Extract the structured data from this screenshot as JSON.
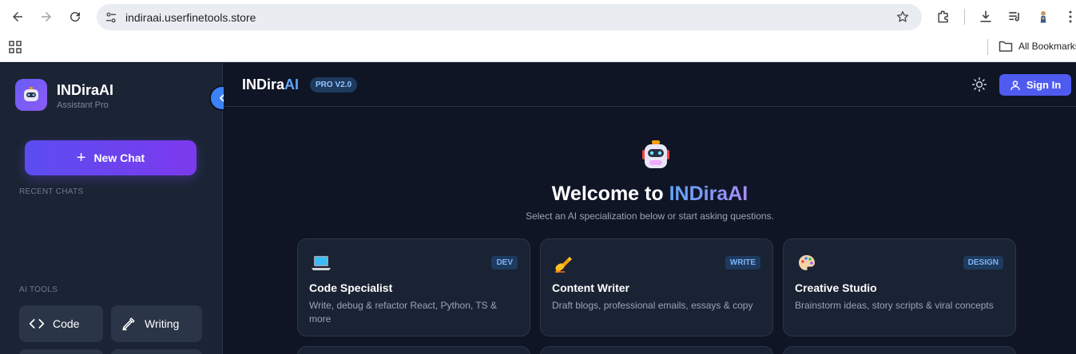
{
  "browser": {
    "url": "indiraai.userfinetools.store",
    "bookmarks_label": "All Bookmarks"
  },
  "sidebar": {
    "app_name": "INDiraAI",
    "app_sub": "Assistant Pro",
    "new_chat_label": "New Chat",
    "recent_label": "RECENT CHATS",
    "tools_label": "AI TOOLS",
    "tools": [
      {
        "label": "Code",
        "icon": "code-icon"
      },
      {
        "label": "Writing",
        "icon": "pen-icon"
      }
    ]
  },
  "header": {
    "brand_main": "INDira",
    "brand_ai": "AI",
    "badge": "PRO V2.0",
    "signin_label": "Sign In"
  },
  "hero": {
    "welcome_prefix": "Welcome to ",
    "welcome_brand": "INDiraAI",
    "subtitle": "Select an AI specialization below or start asking questions."
  },
  "cards": [
    {
      "tag": "DEV",
      "title": "Code Specialist",
      "desc": "Write, debug & refactor React, Python, TS & more",
      "icon": "laptop-icon"
    },
    {
      "tag": "WRITE",
      "title": "Content Writer",
      "desc": "Draft blogs, professional emails, essays & copy",
      "icon": "writing-hand-icon"
    },
    {
      "tag": "DESIGN",
      "title": "Creative Studio",
      "desc": "Brainstorm ideas, story scripts & viral concepts",
      "icon": "palette-icon"
    }
  ],
  "colors": {
    "accent": "#5b4df0",
    "sidebar_bg": "#1b2434",
    "main_bg": "#0f1525",
    "link_blue": "#60a5fa"
  }
}
